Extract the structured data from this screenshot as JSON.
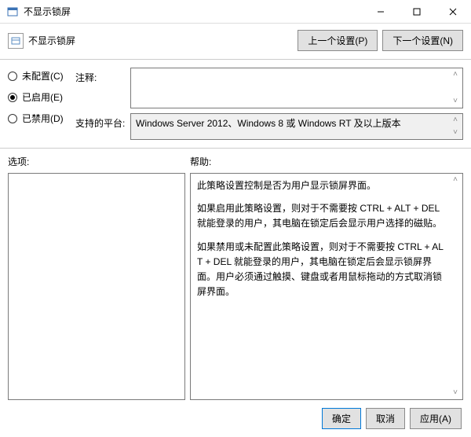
{
  "window": {
    "title": "不显示锁屏"
  },
  "header": {
    "title": "不显示锁屏",
    "prev_btn": "上一个设置(P)",
    "next_btn": "下一个设置(N)"
  },
  "radios": {
    "not_configured": "未配置(C)",
    "enabled": "已启用(E)",
    "disabled": "已禁用(D)",
    "selected": "enabled"
  },
  "fields": {
    "comment_label": "注释:",
    "comment_value": "",
    "platform_label": "支持的平台:",
    "platform_value": "Windows Server 2012、Windows 8 或 Windows RT 及以上版本"
  },
  "options": {
    "label": "选项:"
  },
  "help": {
    "label": "帮助:",
    "p1": "此策略设置控制是否为用户显示锁屏界面。",
    "p2": "如果启用此策略设置，则对于不需要按 CTRL + ALT + DEL  就能登录的用户，其电脑在锁定后会显示用户选择的磁贴。",
    "p3": "如果禁用或未配置此策略设置，则对于不需要按 CTRL + ALT + DEL 就能登录的用户，其电脑在锁定后会显示锁屏界面。用户必须通过触摸、键盘或者用鼠标拖动的方式取消锁屏界面。"
  },
  "footer": {
    "ok": "确定",
    "cancel": "取消",
    "apply": "应用(A)"
  }
}
